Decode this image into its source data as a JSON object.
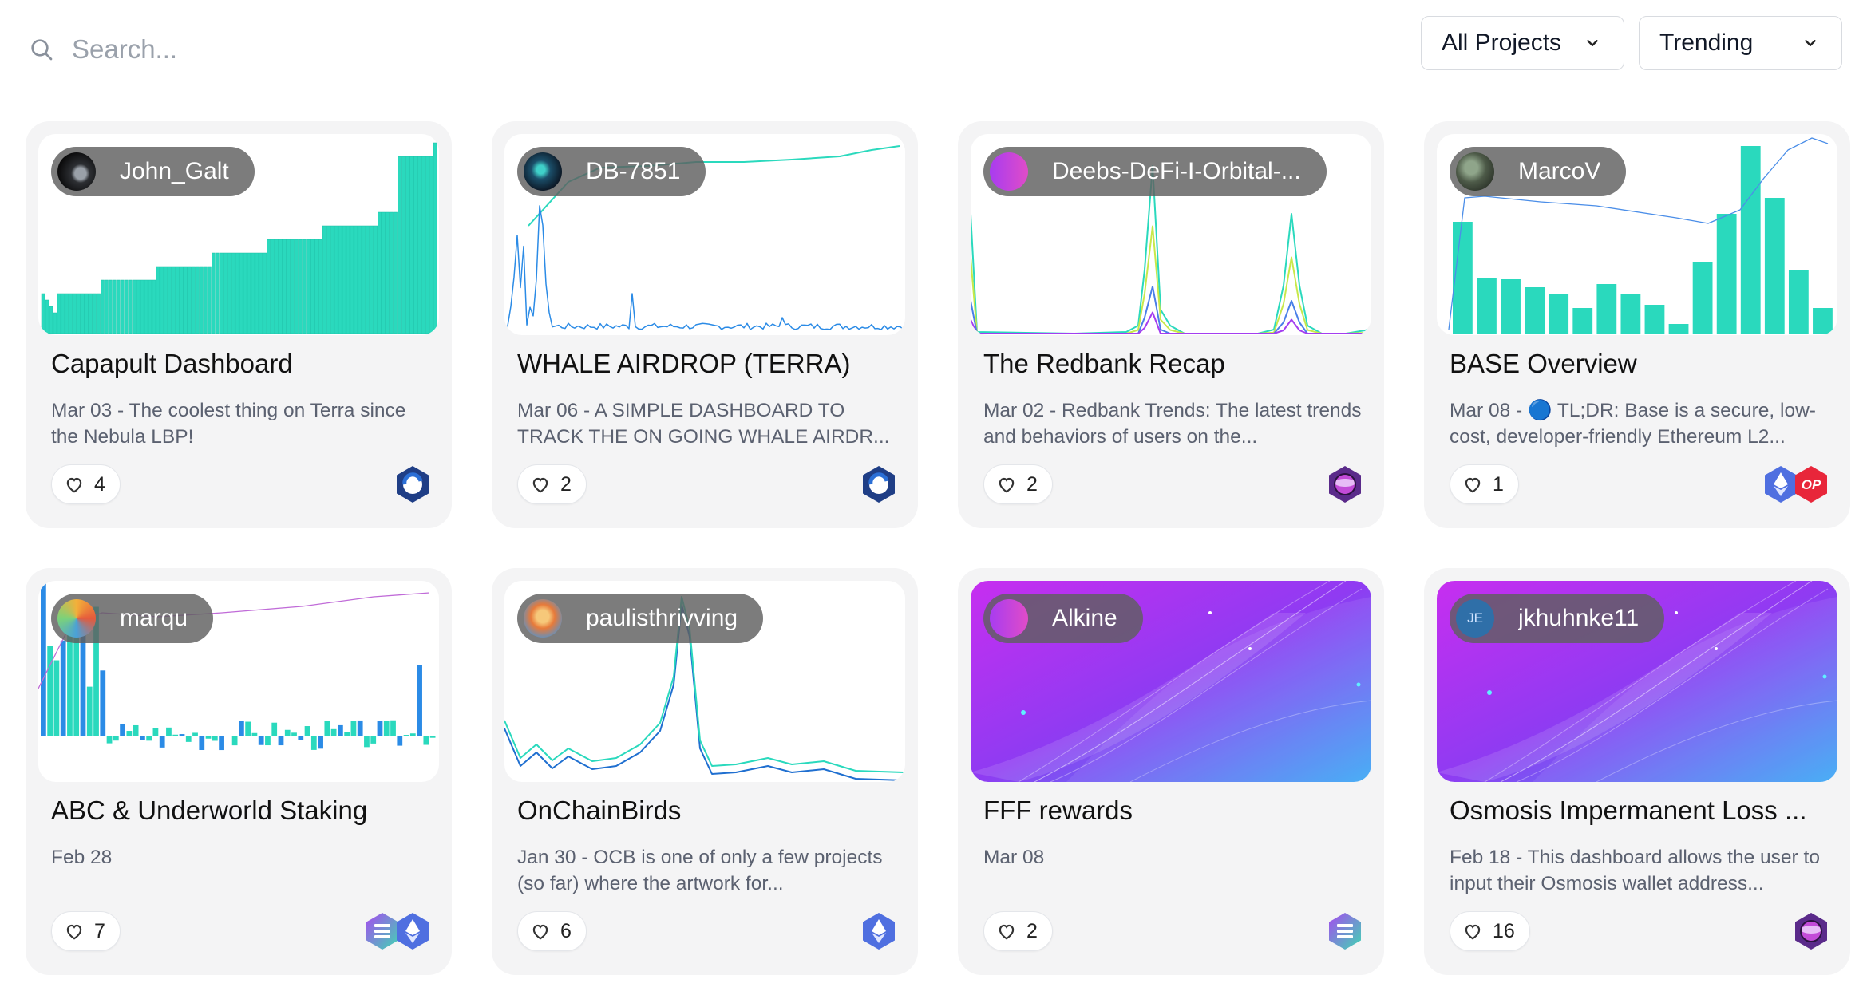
{
  "search": {
    "placeholder": "Search..."
  },
  "filters": {
    "projects": {
      "selected": "All Projects"
    },
    "sort": {
      "selected": "Trending"
    }
  },
  "cards": [
    {
      "author": "John_Galt",
      "title": "Capapult Dashboard",
      "description": "Mar 03 - The coolest thing on Terra since the Nebula LBP!",
      "likes": "4",
      "chains": [
        "terra"
      ],
      "preview": "bar-rising"
    },
    {
      "author": "DB-7851",
      "title": "WHALE AIRDROP (TERRA)",
      "description": "Mar 06 - A SIMPLE DASHBOARD TO TRACK THE ON GOING WHALE AIRDR...",
      "likes": "2",
      "chains": [
        "terra"
      ],
      "preview": "line-spike"
    },
    {
      "author": "Deebs-DeFi-I-Orbital-...",
      "title": "The Redbank Recap",
      "description": "Mar 02 - Redbank Trends: The latest trends and behaviors of users on the...",
      "likes": "2",
      "chains": [
        "osmosis"
      ],
      "preview": "multi-line"
    },
    {
      "author": "MarcoV",
      "title": "BASE Overview",
      "description": "Mar 08 - 🔵 TL;DR: Base is a secure, low-cost, developer-friendly Ethereum L2...",
      "likes": "1",
      "chains": [
        "ethereum",
        "optimism"
      ],
      "preview": "bar-line"
    },
    {
      "author": "marqu",
      "title": "ABC & Underworld Staking",
      "description": "Feb 28",
      "likes": "7",
      "chains": [
        "solana",
        "ethereum"
      ],
      "preview": "bar-neg"
    },
    {
      "author": "paulisthrivving",
      "title": "OnChainBirds",
      "description": "Jan 30 - OCB is one of only a few projects (so far) where the artwork for...",
      "likes": "6",
      "chains": [
        "ethereum"
      ],
      "preview": "two-line"
    },
    {
      "author": "Alkine",
      "title": "FFF rewards",
      "description": "Mar 08",
      "likes": "2",
      "chains": [
        "solana"
      ],
      "preview": "gradient-art"
    },
    {
      "author": "jkhuhnke11",
      "avatar_initials": "JE",
      "title": "Osmosis Impermanent Loss ...",
      "description": "Feb 18 - This dashboard allows the user to input their Osmosis wallet address...",
      "likes": "16",
      "chains": [
        "osmosis"
      ],
      "preview": "gradient-art"
    }
  ],
  "colors": {
    "teal": "#2ad9bd",
    "blue": "#2b8be6",
    "purple": "#a43ef0",
    "card_bg": "#f4f4f5"
  }
}
